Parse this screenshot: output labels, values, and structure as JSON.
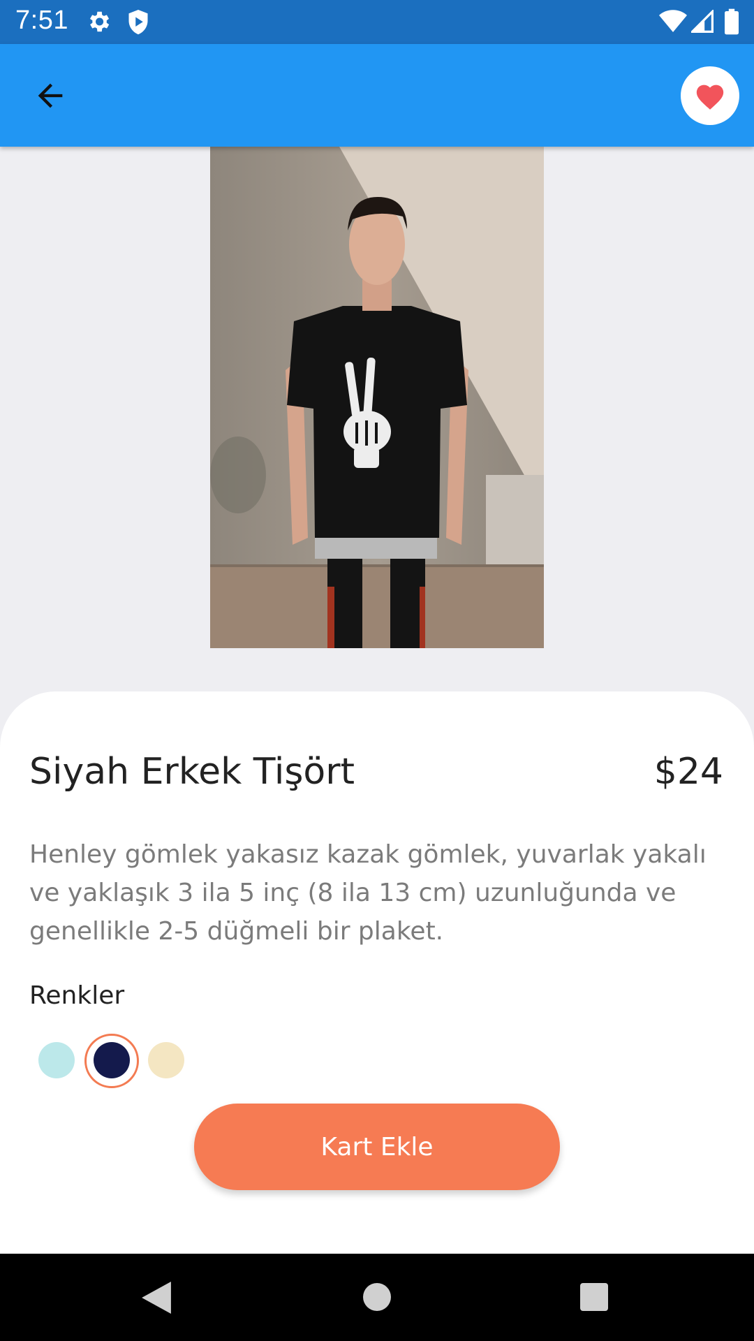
{
  "status_bar": {
    "time": "7:51",
    "left_icons": [
      "settings-icon",
      "shield-play-icon"
    ],
    "right_icons": [
      "wifi-icon",
      "signal-icon",
      "battery-icon"
    ]
  },
  "app_bar": {
    "back_icon": "arrow-left-icon",
    "favorite_icon": "heart-icon",
    "colors": {
      "bar": "#2196F3",
      "status": "#1B6FBF",
      "heart": "#F2545B"
    }
  },
  "product": {
    "title": "Siyah Erkek Tişört",
    "price": "$24",
    "description": "Henley gömlek yakasız kazak gömlek, yuvarlak yakalı ve yaklaşık 3 ila 5 inç (8 ila 13 cm) uzunluğunda ve genellikle 2-5 düğmeli bir plaket.",
    "colors_label": "Renkler",
    "color_options": [
      {
        "color": "#BCE8EA",
        "selected": false
      },
      {
        "color": "#141A4C",
        "selected": true
      },
      {
        "color": "#F4E6C2",
        "selected": false
      }
    ],
    "cta_label": "Kart Ekle",
    "accent": "#F67B53"
  },
  "nav_bar": {
    "icons": [
      "nav-back-icon",
      "nav-home-icon",
      "nav-recents-icon"
    ]
  }
}
